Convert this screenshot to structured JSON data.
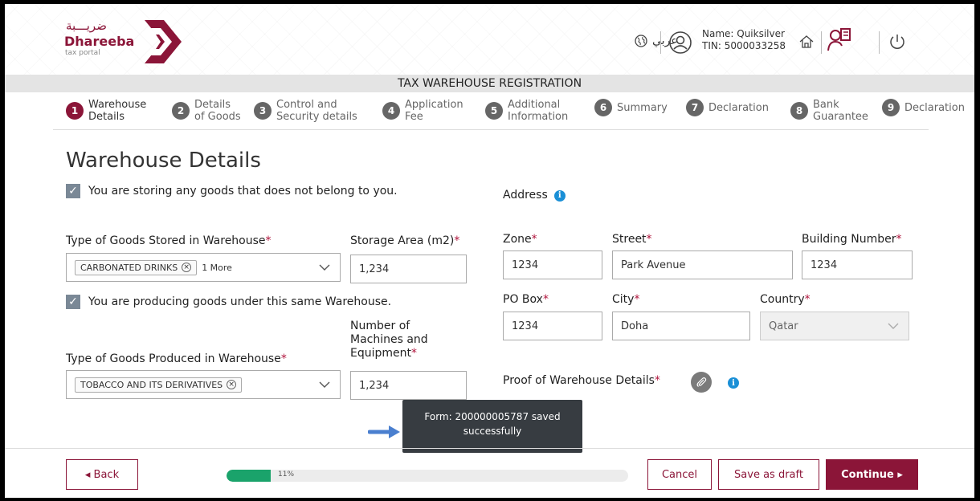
{
  "header": {
    "logo_arabic": "ضريـــبة",
    "logo_name": "Dhareeba",
    "logo_sub": "tax portal",
    "language": "عربي",
    "user_name": "Name: Quiksilver",
    "user_tin": "TIN: 5000033258"
  },
  "title_bar": "TAX WAREHOUSE REGISTRATION",
  "steps": [
    {
      "num": "1",
      "l1": "Warehouse",
      "l2": "Details"
    },
    {
      "num": "2",
      "l1": "Details",
      "l2": "of Goods"
    },
    {
      "num": "3",
      "l1": "Control and",
      "l2": "Security details"
    },
    {
      "num": "4",
      "l1": "Application",
      "l2": "Fee"
    },
    {
      "num": "5",
      "l1": "Additional",
      "l2": "Information"
    },
    {
      "num": "6",
      "l1": "Summary",
      "l2": ""
    },
    {
      "num": "7",
      "l1": "Declaration",
      "l2": ""
    },
    {
      "num": "8",
      "l1": "Bank",
      "l2": "Guarantee"
    },
    {
      "num": "9",
      "l1": "Declaration",
      "l2": ""
    }
  ],
  "page_title": "Warehouse Details",
  "form": {
    "check_storing": "You are storing any goods that does not belong to you.",
    "goods_stored_label": "Type of Goods Stored in Warehouse",
    "goods_stored_chip": "CARBONATED DRINKS",
    "goods_stored_more": "1 More",
    "storage_area_label": "Storage Area (m2)",
    "storage_area_value": "1,234",
    "check_producing": "You are producing goods under this same Warehouse.",
    "goods_produced_label": "Type of Goods Produced in Warehouse",
    "goods_produced_chip": "TOBACCO AND ITS DERIVATIVES",
    "machines_label_1": "Number of",
    "machines_label_2": "Machines and",
    "machines_label_3": "Equipment",
    "machines_value": "1,234",
    "address_label": "Address",
    "zone_label": "Zone",
    "zone_value": "1234",
    "street_label": "Street",
    "street_value": "Park Avenue",
    "building_label": "Building Number",
    "building_value": "1234",
    "pobox_label": "PO Box",
    "pobox_value": "1234",
    "city_label": "City",
    "city_value": "Doha",
    "country_label": "Country",
    "country_value": "Qatar",
    "proof_label": "Proof of Warehouse Details",
    "required_mark": "*"
  },
  "toast": {
    "line1": "Form: 200000005787 saved",
    "line2": "successfully"
  },
  "footer": {
    "back": "◂  Back",
    "progress_value": 0.11,
    "progress_text": "11%",
    "cancel": "Cancel",
    "save_draft": "Save as draft",
    "continue": "Continue  ▸"
  },
  "colors": {
    "brand": "#8b1538",
    "progress": "#1aa36b",
    "info": "#1a8fd6",
    "toast_bg": "#373c41"
  }
}
